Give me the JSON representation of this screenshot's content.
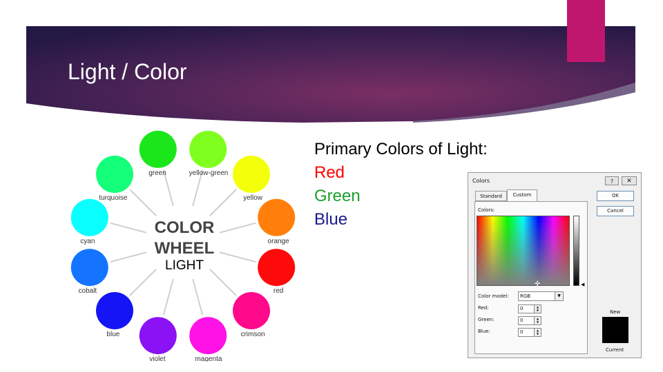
{
  "slide": {
    "title": "Light / Color"
  },
  "colors": {
    "banner_dark": "#2c1b4a",
    "banner_mid": "#6a2b5f",
    "accent": "#c0176e"
  },
  "wheel": {
    "heading_line1": "COLOR",
    "heading_line2": "WHEEL",
    "caption": "LIGHT",
    "swatches": [
      {
        "name": "yellow-green",
        "color": "#7fff1f"
      },
      {
        "name": "yellow",
        "color": "#f4ff0a"
      },
      {
        "name": "orange",
        "color": "#ff7f0a"
      },
      {
        "name": "red",
        "color": "#ff0a0a"
      },
      {
        "name": "crimson",
        "color": "#ff0a8a"
      },
      {
        "name": "magenta",
        "color": "#ff12e6"
      },
      {
        "name": "violet",
        "color": "#8a12f4"
      },
      {
        "name": "blue",
        "color": "#1414f4"
      },
      {
        "name": "cobalt",
        "color": "#1474ff"
      },
      {
        "name": "cyan",
        "color": "#0affff"
      },
      {
        "name": "turquoise",
        "color": "#14ff7a"
      },
      {
        "name": "green",
        "color": "#1ae61a"
      }
    ]
  },
  "primary": {
    "heading": "Primary Colors of Light:",
    "items": [
      {
        "label": "Red",
        "color": "#ff0000"
      },
      {
        "label": "Green",
        "color": "#1f9e2c"
      },
      {
        "label": "Blue",
        "color": "#1a1a8c"
      }
    ]
  },
  "dialog": {
    "title": "Colors",
    "help": "?",
    "close": "✕",
    "tab_standard": "Standard",
    "tab_custom": "Custom",
    "colors_label": "Colors:",
    "model_label": "Color model:",
    "model_value": "RGB",
    "red_label": "Red:",
    "green_label": "Green:",
    "blue_label": "Blue:",
    "red_value": "0",
    "green_value": "0",
    "blue_value": "0",
    "ok": "OK",
    "cancel": "Cancel",
    "new_label": "New",
    "current_label": "Current",
    "new_color": "#000000"
  }
}
